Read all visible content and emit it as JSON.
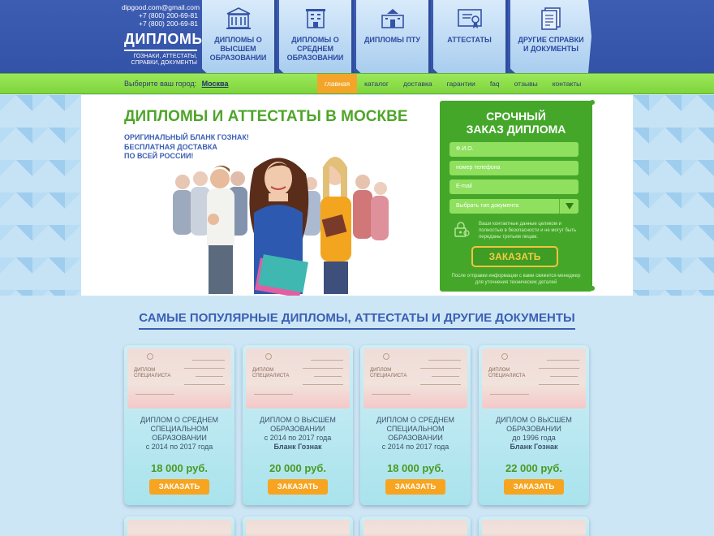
{
  "header": {
    "email": "dipgood.com@gmail.com",
    "phone1": "+7 (800) 200-69-81",
    "phone2": "+7 (800) 200-69-81",
    "logo_title": "ДИПЛОМЫ",
    "logo_subtitle": "ГОЗНАКИ, АТТЕСТАТЫ, СПРАВКИ, ДОКУМЕНТЫ",
    "tiles": [
      {
        "label": "ДИПЛОМЫ О ВЫСШЕМ ОБРАЗОВАНИИ",
        "icon": "university-icon"
      },
      {
        "label": "ДИПЛОМЫ О СРЕДНЕМ ОБРАЗОВАНИИ",
        "icon": "school-icon"
      },
      {
        "label": "ДИПЛОМЫ ПТУ",
        "icon": "college-icon"
      },
      {
        "label": "АТТЕСТАТЫ",
        "icon": "certificate-icon"
      },
      {
        "label": "ДРУГИЕ СПРАВКИ И ДОКУМЕНТЫ",
        "icon": "documents-icon"
      }
    ]
  },
  "citybar": {
    "prompt": "Выберите ваш город:",
    "city": "Москва",
    "menu": [
      "главная",
      "каталог",
      "доставка",
      "гарантии",
      "faq",
      "отзывы",
      "контакты"
    ],
    "active": "главная"
  },
  "hero": {
    "title": "ДИПЛОМЫ И АТТЕСТАТЫ В МОСКВЕ",
    "sub1": "ОРИГИНАЛЬНЫЙ БЛАНК ГОЗНАК!",
    "sub2": "БЕСПЛАТНАЯ ДОСТАВКА",
    "sub3": "ПО ВСЕЙ РОССИИ!"
  },
  "order": {
    "title1": "СРОЧНЫЙ",
    "title2": "ЗАКАЗ ДИПЛОМА",
    "name_placeholder": "Ф.И.О.",
    "phone_placeholder": "номер телефона",
    "email_placeholder": "E-mail",
    "doc_type_placeholder": "Выбрать тип документа",
    "privacy": "Ваши контактные данные целиком и полностью в безопасности и не могут быть переданы третьим лицам.",
    "button": "ЗАКАЗАТЬ",
    "note": "После отправки информации с вами свяжется менеджер для уточнения технических деталей"
  },
  "popular": {
    "title": "САМЫЕ ПОПУЛЯРНЫЕ ДИПЛОМЫ, АТТЕСТАТЫ И ДРУГИЕ ДОКУМЕНТЫ",
    "doc_label_1": "ДИПЛОМ",
    "doc_label_2": "СПЕЦИАЛИСТА",
    "cards": [
      {
        "l1": "ДИПЛОМ О СРЕДНЕМ",
        "l2": "СПЕЦИАЛЬНОМ",
        "l3": "ОБРАЗОВАНИИ",
        "l4": "с 2014 по 2017 года",
        "extra": "",
        "price": "18 000 руб.",
        "button": "ЗАКАЗАТЬ"
      },
      {
        "l1": "ДИПЛОМ О ВЫСШЕМ",
        "l2": "ОБРАЗОВАНИИ",
        "l3": "с 2014 по 2017 года",
        "l4": "",
        "extra": "Бланк Гознак",
        "price": "20 000 руб.",
        "button": "ЗАКАЗАТЬ"
      },
      {
        "l1": "ДИПЛОМ О СРЕДНЕМ",
        "l2": "СПЕЦИАЛЬНОМ",
        "l3": "ОБРАЗОВАНИИ",
        "l4": "с 2014 по 2017 года",
        "extra": "",
        "price": "18 000 руб.",
        "button": "ЗАКАЗАТЬ"
      },
      {
        "l1": "ДИПЛОМ О ВЫСШЕМ",
        "l2": "ОБРАЗОВАНИИ",
        "l3": "до 1996 года",
        "l4": "",
        "extra": "Бланк Гознак",
        "price": "22 000 руб.",
        "button": "ЗАКАЗАТЬ"
      }
    ]
  },
  "colors": {
    "header_blue": "#3353a8",
    "green": "#44a72a",
    "orange": "#f7a521",
    "price_green": "#4a9a22"
  }
}
